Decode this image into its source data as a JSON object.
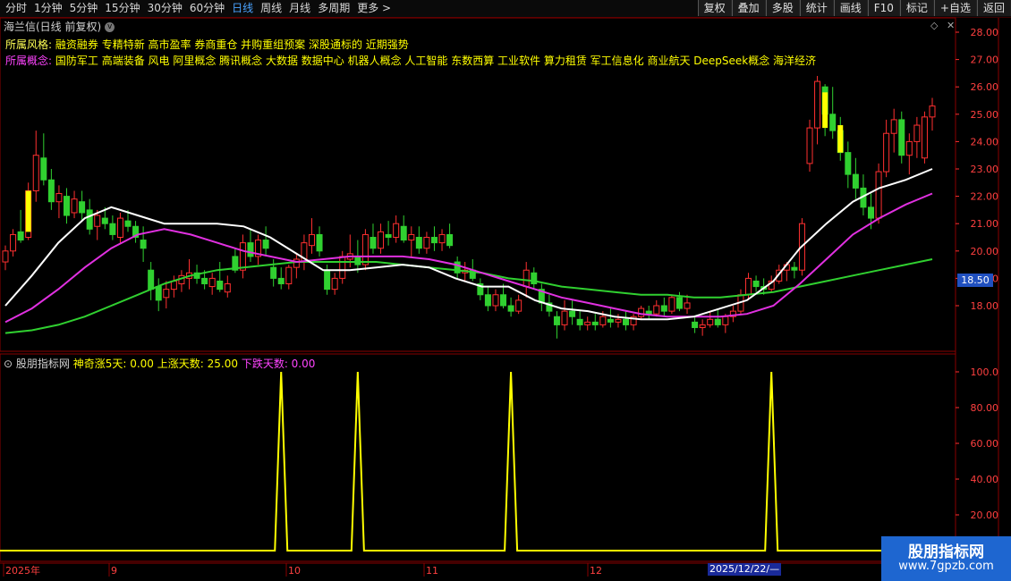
{
  "toolbar": {
    "periods": [
      "分时",
      "1分钟",
      "5分钟",
      "15分钟",
      "30分钟",
      "60分钟",
      "日线",
      "周线",
      "月线",
      "多周期",
      "更多 >"
    ],
    "active_period": "日线",
    "right_buttons": [
      "复权",
      "叠加",
      "多股",
      "统计",
      "画线",
      "F10",
      "标记",
      "+自选",
      "返回"
    ]
  },
  "stock": {
    "title": "海兰信(日线 前复权)",
    "style_label": "所属风格:",
    "styles": "融资融券 专精特新 高市盈率 券商重仓 并购重组预案 深股通标的 近期强势",
    "concept_label": "所属概念:",
    "concepts": "国防军工 高端装备 风电 阿里概念 腾讯概念 大数据 数据中心 机器人概念 人工智能 东数西算 工业软件 算力租赁 军工信息化 商业航天 DeepSeek概念 海洋经济"
  },
  "price_axis": {
    "ticks": [
      "28.00",
      "27.00",
      "26.00",
      "25.00",
      "24.00",
      "23.00",
      "22.00",
      "21.00",
      "20.00",
      "19.00",
      "18.00"
    ],
    "current_price": "18.50"
  },
  "indicator": {
    "name": "股朋指标网",
    "item1": "神奇涨5天: 0.00",
    "item2": "上涨天数: 25.00",
    "item3": "下跌天数: 0.00",
    "ticks": [
      "100.0",
      "80.00",
      "60.00",
      "40.00",
      "20.00"
    ]
  },
  "time_axis": {
    "labels": [
      "2025年",
      "9",
      "10",
      "11",
      "12"
    ],
    "highlight_date": "2025/12/22/—"
  },
  "watermark": {
    "line1": "股朋指标网",
    "line2": "www.7gpzb.com"
  },
  "colors": {
    "up": "#ff3030",
    "down": "#30d030",
    "ma_white": "#ffffff",
    "ma_magenta": "#e030e0",
    "ma_green": "#30d030",
    "signal": "#ffff00"
  },
  "chart_data": {
    "type": "candlestick",
    "candles": [
      [
        19.6,
        20.2,
        19.3,
        20.0
      ],
      [
        20.0,
        20.8,
        19.8,
        20.6
      ],
      [
        20.7,
        21.5,
        20.3,
        20.4
      ],
      [
        20.5,
        22.5,
        20.4,
        22.2
      ],
      [
        22.2,
        24.4,
        21.8,
        23.5
      ],
      [
        23.4,
        24.3,
        22.4,
        22.6
      ],
      [
        22.6,
        23.0,
        21.5,
        21.8
      ],
      [
        21.8,
        22.4,
        21.2,
        22.1
      ],
      [
        22.0,
        22.3,
        21.0,
        21.3
      ],
      [
        21.4,
        22.2,
        21.2,
        21.9
      ],
      [
        21.8,
        22.2,
        21.1,
        21.4
      ],
      [
        21.5,
        21.9,
        20.6,
        20.8
      ],
      [
        20.9,
        21.5,
        20.4,
        21.3
      ],
      [
        21.2,
        21.6,
        20.8,
        21.0
      ],
      [
        21.0,
        21.3,
        20.4,
        20.6
      ],
      [
        20.5,
        21.4,
        20.3,
        21.2
      ],
      [
        21.1,
        21.5,
        20.7,
        20.9
      ],
      [
        20.9,
        21.1,
        20.3,
        20.5
      ],
      [
        20.4,
        20.9,
        19.6,
        20.1
      ],
      [
        19.3,
        19.6,
        18.2,
        18.6
      ],
      [
        18.7,
        19.0,
        17.8,
        18.2
      ],
      [
        18.3,
        18.9,
        17.9,
        18.6
      ],
      [
        18.6,
        19.1,
        18.3,
        18.9
      ],
      [
        18.8,
        19.3,
        18.5,
        19.1
      ],
      [
        19.0,
        19.7,
        18.6,
        19.2
      ],
      [
        19.2,
        19.5,
        18.8,
        19.0
      ],
      [
        19.0,
        19.3,
        18.6,
        18.8
      ],
      [
        18.7,
        19.2,
        18.4,
        19.0
      ],
      [
        18.9,
        19.6,
        18.5,
        18.6
      ],
      [
        18.5,
        19.1,
        18.3,
        18.8
      ],
      [
        19.8,
        20.1,
        19.2,
        19.3
      ],
      [
        19.3,
        20.6,
        19.0,
        20.3
      ],
      [
        20.3,
        20.8,
        19.6,
        19.8
      ],
      [
        19.8,
        20.6,
        19.5,
        20.4
      ],
      [
        20.4,
        20.9,
        19.8,
        20.1
      ],
      [
        19.4,
        19.7,
        18.7,
        19.0
      ],
      [
        19.0,
        19.4,
        18.6,
        18.8
      ],
      [
        18.8,
        19.5,
        18.6,
        19.4
      ],
      [
        19.4,
        19.9,
        19.0,
        19.7
      ],
      [
        19.6,
        20.6,
        19.3,
        20.3
      ],
      [
        20.2,
        21.2,
        19.9,
        20.6
      ],
      [
        20.6,
        20.9,
        19.8,
        20.0
      ],
      [
        19.3,
        19.5,
        18.4,
        18.6
      ],
      [
        18.6,
        19.2,
        18.4,
        19.0
      ],
      [
        19.0,
        20.0,
        18.8,
        19.8
      ],
      [
        19.7,
        20.6,
        19.4,
        19.9
      ],
      [
        19.8,
        20.4,
        19.2,
        19.5
      ],
      [
        19.5,
        20.8,
        19.3,
        20.6
      ],
      [
        20.5,
        21.0,
        19.9,
        20.1
      ],
      [
        20.1,
        21.0,
        19.9,
        20.7
      ],
      [
        20.6,
        21.1,
        20.2,
        20.5
      ],
      [
        20.5,
        21.3,
        20.3,
        21.0
      ],
      [
        20.9,
        21.3,
        20.3,
        20.4
      ],
      [
        20.4,
        20.9,
        19.8,
        20.6
      ],
      [
        20.5,
        20.9,
        19.9,
        20.1
      ],
      [
        20.1,
        20.7,
        19.9,
        20.5
      ],
      [
        20.5,
        20.9,
        20.0,
        20.3
      ],
      [
        20.3,
        20.8,
        20.0,
        20.6
      ],
      [
        20.6,
        21.0,
        20.1,
        20.2
      ],
      [
        19.6,
        19.8,
        19.0,
        19.2
      ],
      [
        19.2,
        19.6,
        18.9,
        19.3
      ],
      [
        19.3,
        19.7,
        18.9,
        19.0
      ],
      [
        18.8,
        19.0,
        18.2,
        18.4
      ],
      [
        18.4,
        18.7,
        17.8,
        18.0
      ],
      [
        18.0,
        18.6,
        17.8,
        18.4
      ],
      [
        18.4,
        18.8,
        17.9,
        18.0
      ],
      [
        18.0,
        18.3,
        17.6,
        17.8
      ],
      [
        17.8,
        18.4,
        17.7,
        18.2
      ],
      [
        18.7,
        19.6,
        18.3,
        19.3
      ],
      [
        19.2,
        19.4,
        18.6,
        18.8
      ],
      [
        18.6,
        18.8,
        17.8,
        18.1
      ],
      [
        18.1,
        18.4,
        17.6,
        17.8
      ],
      [
        17.6,
        17.8,
        16.8,
        17.3
      ],
      [
        17.3,
        18.2,
        17.1,
        17.8
      ],
      [
        17.8,
        18.2,
        17.3,
        17.6
      ],
      [
        17.5,
        17.8,
        17.1,
        17.3
      ],
      [
        17.3,
        17.6,
        17.1,
        17.4
      ],
      [
        17.4,
        17.7,
        17.1,
        17.3
      ],
      [
        17.3,
        17.8,
        17.2,
        17.6
      ],
      [
        17.5,
        17.9,
        17.2,
        17.4
      ],
      [
        17.4,
        17.7,
        17.2,
        17.5
      ],
      [
        17.5,
        17.8,
        17.1,
        17.3
      ],
      [
        17.3,
        17.7,
        17.1,
        17.6
      ],
      [
        17.6,
        18.0,
        17.5,
        17.9
      ],
      [
        17.8,
        18.0,
        17.5,
        17.7
      ],
      [
        17.7,
        18.2,
        17.6,
        18.0
      ],
      [
        18.0,
        18.3,
        17.6,
        17.8
      ],
      [
        17.8,
        18.4,
        17.7,
        18.3
      ],
      [
        18.3,
        18.5,
        17.8,
        17.9
      ],
      [
        17.9,
        18.4,
        17.7,
        18.1
      ],
      [
        17.4,
        17.6,
        17.0,
        17.2
      ],
      [
        17.2,
        17.5,
        16.9,
        17.3
      ],
      [
        17.3,
        17.8,
        17.2,
        17.5
      ],
      [
        17.5,
        17.9,
        17.2,
        17.3
      ],
      [
        17.3,
        17.7,
        17.0,
        17.6
      ],
      [
        17.6,
        18.0,
        17.4,
        17.8
      ],
      [
        17.8,
        18.6,
        17.7,
        18.4
      ],
      [
        18.4,
        19.2,
        18.2,
        19.0
      ],
      [
        18.9,
        19.1,
        18.5,
        18.7
      ],
      [
        18.7,
        19.0,
        18.4,
        18.6
      ],
      [
        18.6,
        19.1,
        18.5,
        18.9
      ],
      [
        18.9,
        19.5,
        18.8,
        19.3
      ],
      [
        19.3,
        19.6,
        18.9,
        19.5
      ],
      [
        19.4,
        19.6,
        19.0,
        19.3
      ],
      [
        19.3,
        21.2,
        19.1,
        21.0
      ],
      [
        23.2,
        24.8,
        22.9,
        24.5
      ],
      [
        24.5,
        26.4,
        23.9,
        26.2
      ],
      [
        26.0,
        26.1,
        24.2,
        25.0
      ],
      [
        25.0,
        26.0,
        24.1,
        24.4
      ],
      [
        24.4,
        24.9,
        23.3,
        23.6
      ],
      [
        23.6,
        24.0,
        22.3,
        22.8
      ],
      [
        22.8,
        23.4,
        21.9,
        22.3
      ],
      [
        22.3,
        22.8,
        21.3,
        21.6
      ],
      [
        21.6,
        22.1,
        20.8,
        21.2
      ],
      [
        21.2,
        23.2,
        21.0,
        22.9
      ],
      [
        22.9,
        24.8,
        22.7,
        24.3
      ],
      [
        24.3,
        25.2,
        23.6,
        24.8
      ],
      [
        24.8,
        25.1,
        23.2,
        23.5
      ],
      [
        23.5,
        24.3,
        22.8,
        24.0
      ],
      [
        24.0,
        24.9,
        23.4,
        24.6
      ],
      [
        23.4,
        25.1,
        23.2,
        24.9
      ],
      [
        24.9,
        25.6,
        24.4,
        25.3
      ]
    ],
    "ma_white": [
      18.0,
      19.1,
      20.3,
      21.2,
      21.6,
      21.3,
      21.0,
      21.0,
      21.0,
      20.9,
      20.5,
      19.9,
      19.3,
      19.3,
      19.4,
      19.5,
      19.4,
      19.0,
      18.7,
      18.7,
      18.2,
      17.9,
      17.8,
      17.6,
      17.5,
      17.5,
      17.6,
      17.9,
      18.2,
      18.9,
      20.1,
      21.0,
      21.8,
      22.3,
      22.6,
      23.0
    ],
    "ma_magenta": [
      17.4,
      17.9,
      18.6,
      19.4,
      20.1,
      20.6,
      20.8,
      20.6,
      20.3,
      20.0,
      19.8,
      19.6,
      19.7,
      19.8,
      19.8,
      19.8,
      19.7,
      19.5,
      19.2,
      18.9,
      18.6,
      18.3,
      18.1,
      17.9,
      17.7,
      17.6,
      17.6,
      17.6,
      17.7,
      18.0,
      18.8,
      19.7,
      20.6,
      21.2,
      21.7,
      22.1
    ],
    "ma_green": [
      17.0,
      17.1,
      17.3,
      17.6,
      18.0,
      18.4,
      18.8,
      19.1,
      19.3,
      19.4,
      19.5,
      19.6,
      19.6,
      19.6,
      19.6,
      19.5,
      19.4,
      19.3,
      19.2,
      19.0,
      18.9,
      18.7,
      18.6,
      18.5,
      18.4,
      18.4,
      18.3,
      18.3,
      18.4,
      18.5,
      18.7,
      18.9,
      19.1,
      19.3,
      19.5,
      19.7
    ],
    "signal_spikes_at_index": [
      36,
      46,
      66,
      100
    ],
    "ylim": [
      16.5,
      28.5
    ],
    "indicator_ylim": [
      0,
      105
    ]
  }
}
